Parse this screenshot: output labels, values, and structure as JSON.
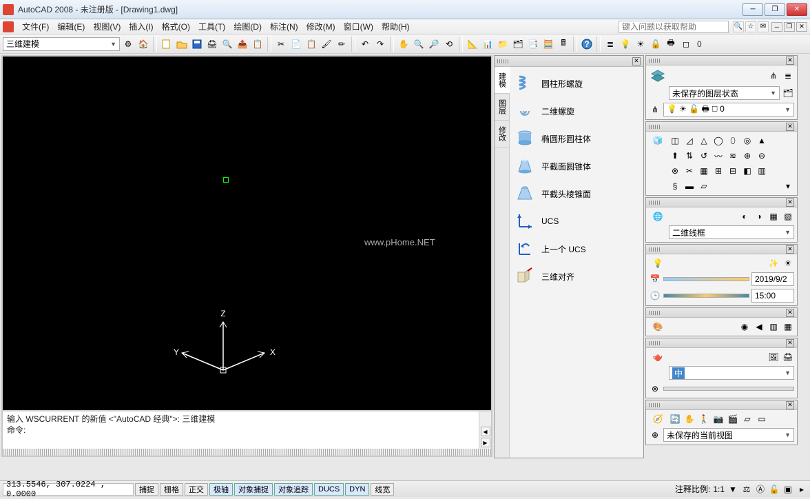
{
  "title": "AutoCAD 2008 - 未注册版 - [Drawing1.dwg]",
  "menu": {
    "file": "文件(F)",
    "edit": "编辑(E)",
    "view": "视图(V)",
    "insert": "插入(I)",
    "format": "格式(O)",
    "tool": "工具(T)",
    "draw": "绘图(D)",
    "dim": "标注(N)",
    "modify": "修改(M)",
    "window": "窗口(W)",
    "help": "帮助(H)"
  },
  "help_placeholder": "键入问题以获取帮助",
  "workspace": "三维建模",
  "layer0": "0",
  "panel_tabs": {
    "t1": "建模",
    "t2": "图层",
    "t3": "修改"
  },
  "palette_items": {
    "helical": "圆柱形螺旋",
    "spiral2d": "二维螺旋",
    "ellcyl": "椭圆形圆柱体",
    "frustcone": "平截面圆锥体",
    "frustpyr": "平截头棱锥面",
    "ucs": "UCS",
    "prevucs": "上一个 UCS",
    "align3d": "三维对齐"
  },
  "side": {
    "layerstate": "未保存的图层状态",
    "layer": "0",
    "wireframe": "二维线框",
    "date": "2019/9/2",
    "time": "15:00",
    "savedview": "未保存的当前视图"
  },
  "cmd": {
    "line1": "输入 WSCURRENT 的新值 <\"AutoCAD 经典\">: 三维建模",
    "line2": "命令:"
  },
  "status": {
    "coord": "313.5546, 307.0224 , 0.0000",
    "snap": "捕捉",
    "grid": "栅格",
    "ortho": "正交",
    "polar": "极轴",
    "osnap": "对象捕捉",
    "otrack": "对象追踪",
    "ducs": "DUCS",
    "dyn": "DYN",
    "lwt": "线宽",
    "ann_label": "注释比例:",
    "ann_scale": "1:1"
  },
  "axes": {
    "x": "X",
    "y": "Y",
    "z": "Z"
  },
  "watermark": "www.pHome.NET"
}
